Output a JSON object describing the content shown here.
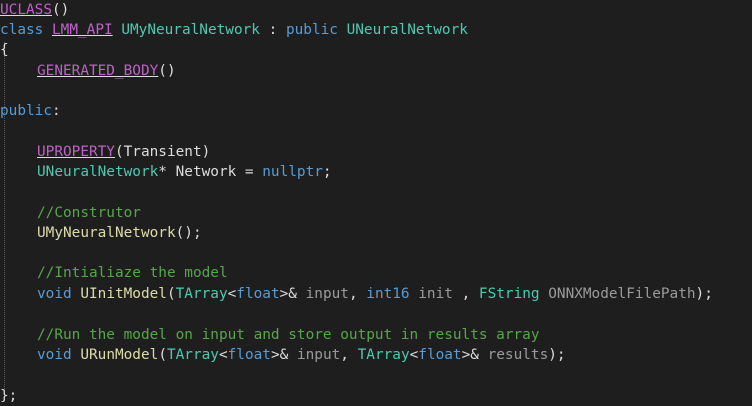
{
  "editor": {
    "lines": {
      "l1": {
        "uclass": "UCLASS",
        "paren": "()"
      },
      "l2": {
        "class_kw": "class",
        "api": "LMM_API",
        "name": "UMyNeuralNetwork",
        "colon": " : ",
        "public_kw": "public",
        "base": "UNeuralNetwork"
      },
      "l3": {
        "brace": "{"
      },
      "l4": {
        "macro": "GENERATED_BODY",
        "paren": "()"
      },
      "l6": {
        "public_kw": "public",
        "colon": ":"
      },
      "l8": {
        "macro": "UPROPERTY",
        "args": "(Transient)"
      },
      "l9": {
        "type": "UNeuralNetwork",
        "ptr": "* Network = ",
        "value": "nullptr",
        "semi": ";"
      },
      "l11": {
        "comment": "//Construtor"
      },
      "l12": {
        "ctor": "UMyNeuralNetwork",
        "rest": "();"
      },
      "l14": {
        "comment": "//Intialiaze the model"
      },
      "l15": {
        "void_kw": "void",
        "func": "UInitModel",
        "p1": "(",
        "tarray": "TArray",
        "lt": "<",
        "float_kw": "float",
        "gt_ref": ">& ",
        "input": "input",
        "comma": ", ",
        "int16_kw": "int16",
        "init": " init ",
        "comma2": ", ",
        "fstring": "FString",
        "onnx": " ONNXModelFilePath",
        "end": ");"
      },
      "l17": {
        "comment": "//Run the model on input and store output in results array"
      },
      "l18": {
        "void_kw": "void",
        "func": "URunModel",
        "p1": "(",
        "tarray": "TArray",
        "lt": "<",
        "float_kw": "float",
        "gt_ref": ">& ",
        "input": "input",
        "comma": ", ",
        "tarray2": "TArray",
        "lt2": "<",
        "float_kw2": "float",
        "gt_ref2": ">& ",
        "results": "results",
        "end": ");"
      },
      "l20": {
        "brace": "};"
      }
    }
  }
}
